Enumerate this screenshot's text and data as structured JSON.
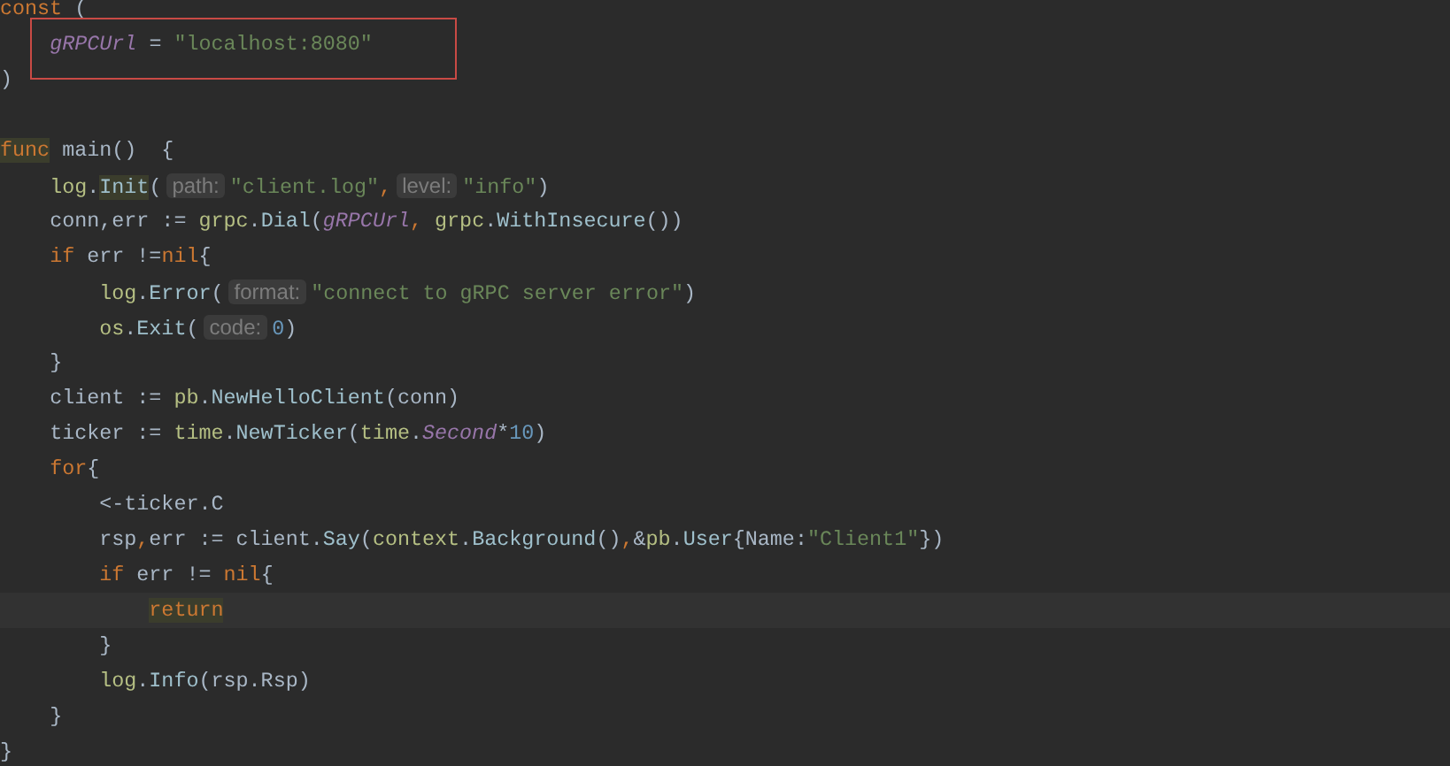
{
  "editor": {
    "lines": [
      {
        "kind": "code",
        "tokens": [
          {
            "kind": "keyword",
            "text": "const"
          },
          {
            "kind": "plain",
            "text": " ("
          }
        ]
      },
      {
        "kind": "code",
        "boxed": true,
        "tokens": [
          {
            "kind": "constant",
            "text": "    gRPCUrl"
          },
          {
            "kind": "plain",
            "text": " = "
          },
          {
            "kind": "string",
            "text": "\"localhost:8080\""
          }
        ]
      },
      {
        "kind": "code",
        "tokens": [
          {
            "kind": "plain",
            "text": ")"
          }
        ]
      },
      {
        "kind": "blank"
      },
      {
        "kind": "code",
        "tokens": [
          {
            "kind": "keyword",
            "text": "func",
            "highlighted": true
          },
          {
            "kind": "plain",
            "text": " main()  {"
          }
        ]
      },
      {
        "kind": "code",
        "tokens": [
          {
            "kind": "package",
            "text": "    log"
          },
          {
            "kind": "plain",
            "text": "."
          },
          {
            "kind": "method",
            "text": "Init",
            "highlighted": true
          },
          {
            "kind": "plain",
            "text": "("
          },
          {
            "kind": "hint",
            "text": "path:"
          },
          {
            "kind": "string",
            "text": "\"client.log\""
          },
          {
            "kind": "keyword",
            "text": ","
          },
          {
            "kind": "hint",
            "text": "level:"
          },
          {
            "kind": "string",
            "text": "\"info\""
          },
          {
            "kind": "plain",
            "text": ")"
          }
        ]
      },
      {
        "kind": "code",
        "tokens": [
          {
            "kind": "plain",
            "text": "    conn,err := "
          },
          {
            "kind": "package",
            "text": "grpc"
          },
          {
            "kind": "plain",
            "text": "."
          },
          {
            "kind": "method",
            "text": "Dial"
          },
          {
            "kind": "plain",
            "text": "("
          },
          {
            "kind": "constant",
            "text": "gRPCUrl"
          },
          {
            "kind": "keyword",
            "text": ","
          },
          {
            "kind": "package",
            "text": " grpc"
          },
          {
            "kind": "plain",
            "text": "."
          },
          {
            "kind": "method",
            "text": "WithInsecure"
          },
          {
            "kind": "plain",
            "text": "())"
          }
        ]
      },
      {
        "kind": "code",
        "tokens": [
          {
            "kind": "keyword",
            "text": "    if"
          },
          {
            "kind": "plain",
            "text": " err !="
          },
          {
            "kind": "keyword",
            "text": "nil"
          },
          {
            "kind": "plain",
            "text": "{"
          }
        ]
      },
      {
        "kind": "code",
        "tokens": [
          {
            "kind": "package",
            "text": "        log"
          },
          {
            "kind": "plain",
            "text": "."
          },
          {
            "kind": "method",
            "text": "Error"
          },
          {
            "kind": "plain",
            "text": "("
          },
          {
            "kind": "hint",
            "text": "format:"
          },
          {
            "kind": "string",
            "text": "\"connect to gRPC server error\""
          },
          {
            "kind": "plain",
            "text": ")"
          }
        ]
      },
      {
        "kind": "code",
        "tokens": [
          {
            "kind": "package",
            "text": "        os"
          },
          {
            "kind": "plain",
            "text": "."
          },
          {
            "kind": "method",
            "text": "Exit"
          },
          {
            "kind": "plain",
            "text": "("
          },
          {
            "kind": "hint",
            "text": "code:"
          },
          {
            "kind": "number",
            "text": "0"
          },
          {
            "kind": "plain",
            "text": ")"
          }
        ]
      },
      {
        "kind": "code",
        "tokens": [
          {
            "kind": "plain",
            "text": "    }"
          }
        ]
      },
      {
        "kind": "code",
        "tokens": [
          {
            "kind": "plain",
            "text": "    client := "
          },
          {
            "kind": "package",
            "text": "pb"
          },
          {
            "kind": "plain",
            "text": "."
          },
          {
            "kind": "method",
            "text": "NewHelloClient"
          },
          {
            "kind": "plain",
            "text": "(conn)"
          }
        ]
      },
      {
        "kind": "code",
        "tokens": [
          {
            "kind": "plain",
            "text": "    ticker := "
          },
          {
            "kind": "package",
            "text": "time"
          },
          {
            "kind": "plain",
            "text": "."
          },
          {
            "kind": "method",
            "text": "NewTicker"
          },
          {
            "kind": "plain",
            "text": "("
          },
          {
            "kind": "package",
            "text": "time"
          },
          {
            "kind": "plain",
            "text": "."
          },
          {
            "kind": "constant",
            "text": "Second"
          },
          {
            "kind": "plain",
            "text": "*"
          },
          {
            "kind": "number",
            "text": "10"
          },
          {
            "kind": "plain",
            "text": ")"
          }
        ]
      },
      {
        "kind": "code",
        "tokens": [
          {
            "kind": "keyword",
            "text": "    for"
          },
          {
            "kind": "plain",
            "text": "{"
          }
        ]
      },
      {
        "kind": "code",
        "tokens": [
          {
            "kind": "plain",
            "text": "        <-ticker.C"
          }
        ]
      },
      {
        "kind": "code",
        "tokens": [
          {
            "kind": "plain",
            "text": "        rsp"
          },
          {
            "kind": "keyword",
            "text": ","
          },
          {
            "kind": "plain",
            "text": "err := client."
          },
          {
            "kind": "method",
            "text": "Say"
          },
          {
            "kind": "plain",
            "text": "("
          },
          {
            "kind": "package",
            "text": "context"
          },
          {
            "kind": "plain",
            "text": "."
          },
          {
            "kind": "method",
            "text": "Background"
          },
          {
            "kind": "plain",
            "text": "()"
          },
          {
            "kind": "keyword",
            "text": ","
          },
          {
            "kind": "plain",
            "text": "&"
          },
          {
            "kind": "package",
            "text": "pb"
          },
          {
            "kind": "plain",
            "text": "."
          },
          {
            "kind": "method",
            "text": "User"
          },
          {
            "kind": "plain",
            "text": "{Name:"
          },
          {
            "kind": "string",
            "text": "\"Client1\""
          },
          {
            "kind": "plain",
            "text": "})"
          }
        ]
      },
      {
        "kind": "code",
        "tokens": [
          {
            "kind": "keyword",
            "text": "        if"
          },
          {
            "kind": "plain",
            "text": " err != "
          },
          {
            "kind": "keyword",
            "text": "nil"
          },
          {
            "kind": "plain",
            "text": "{"
          }
        ]
      },
      {
        "kind": "code",
        "current": true,
        "tokens": [
          {
            "kind": "keyword",
            "text": "            return",
            "highlighted": true
          }
        ]
      },
      {
        "kind": "code",
        "tokens": [
          {
            "kind": "plain",
            "text": "        }"
          }
        ]
      },
      {
        "kind": "code",
        "tokens": [
          {
            "kind": "package",
            "text": "        log"
          },
          {
            "kind": "plain",
            "text": "."
          },
          {
            "kind": "method",
            "text": "Info"
          },
          {
            "kind": "plain",
            "text": "(rsp.Rsp)"
          }
        ]
      },
      {
        "kind": "code",
        "tokens": [
          {
            "kind": "plain",
            "text": "    }"
          }
        ]
      },
      {
        "kind": "code",
        "tokens": [
          {
            "kind": "plain",
            "text": "}"
          }
        ]
      }
    ]
  }
}
